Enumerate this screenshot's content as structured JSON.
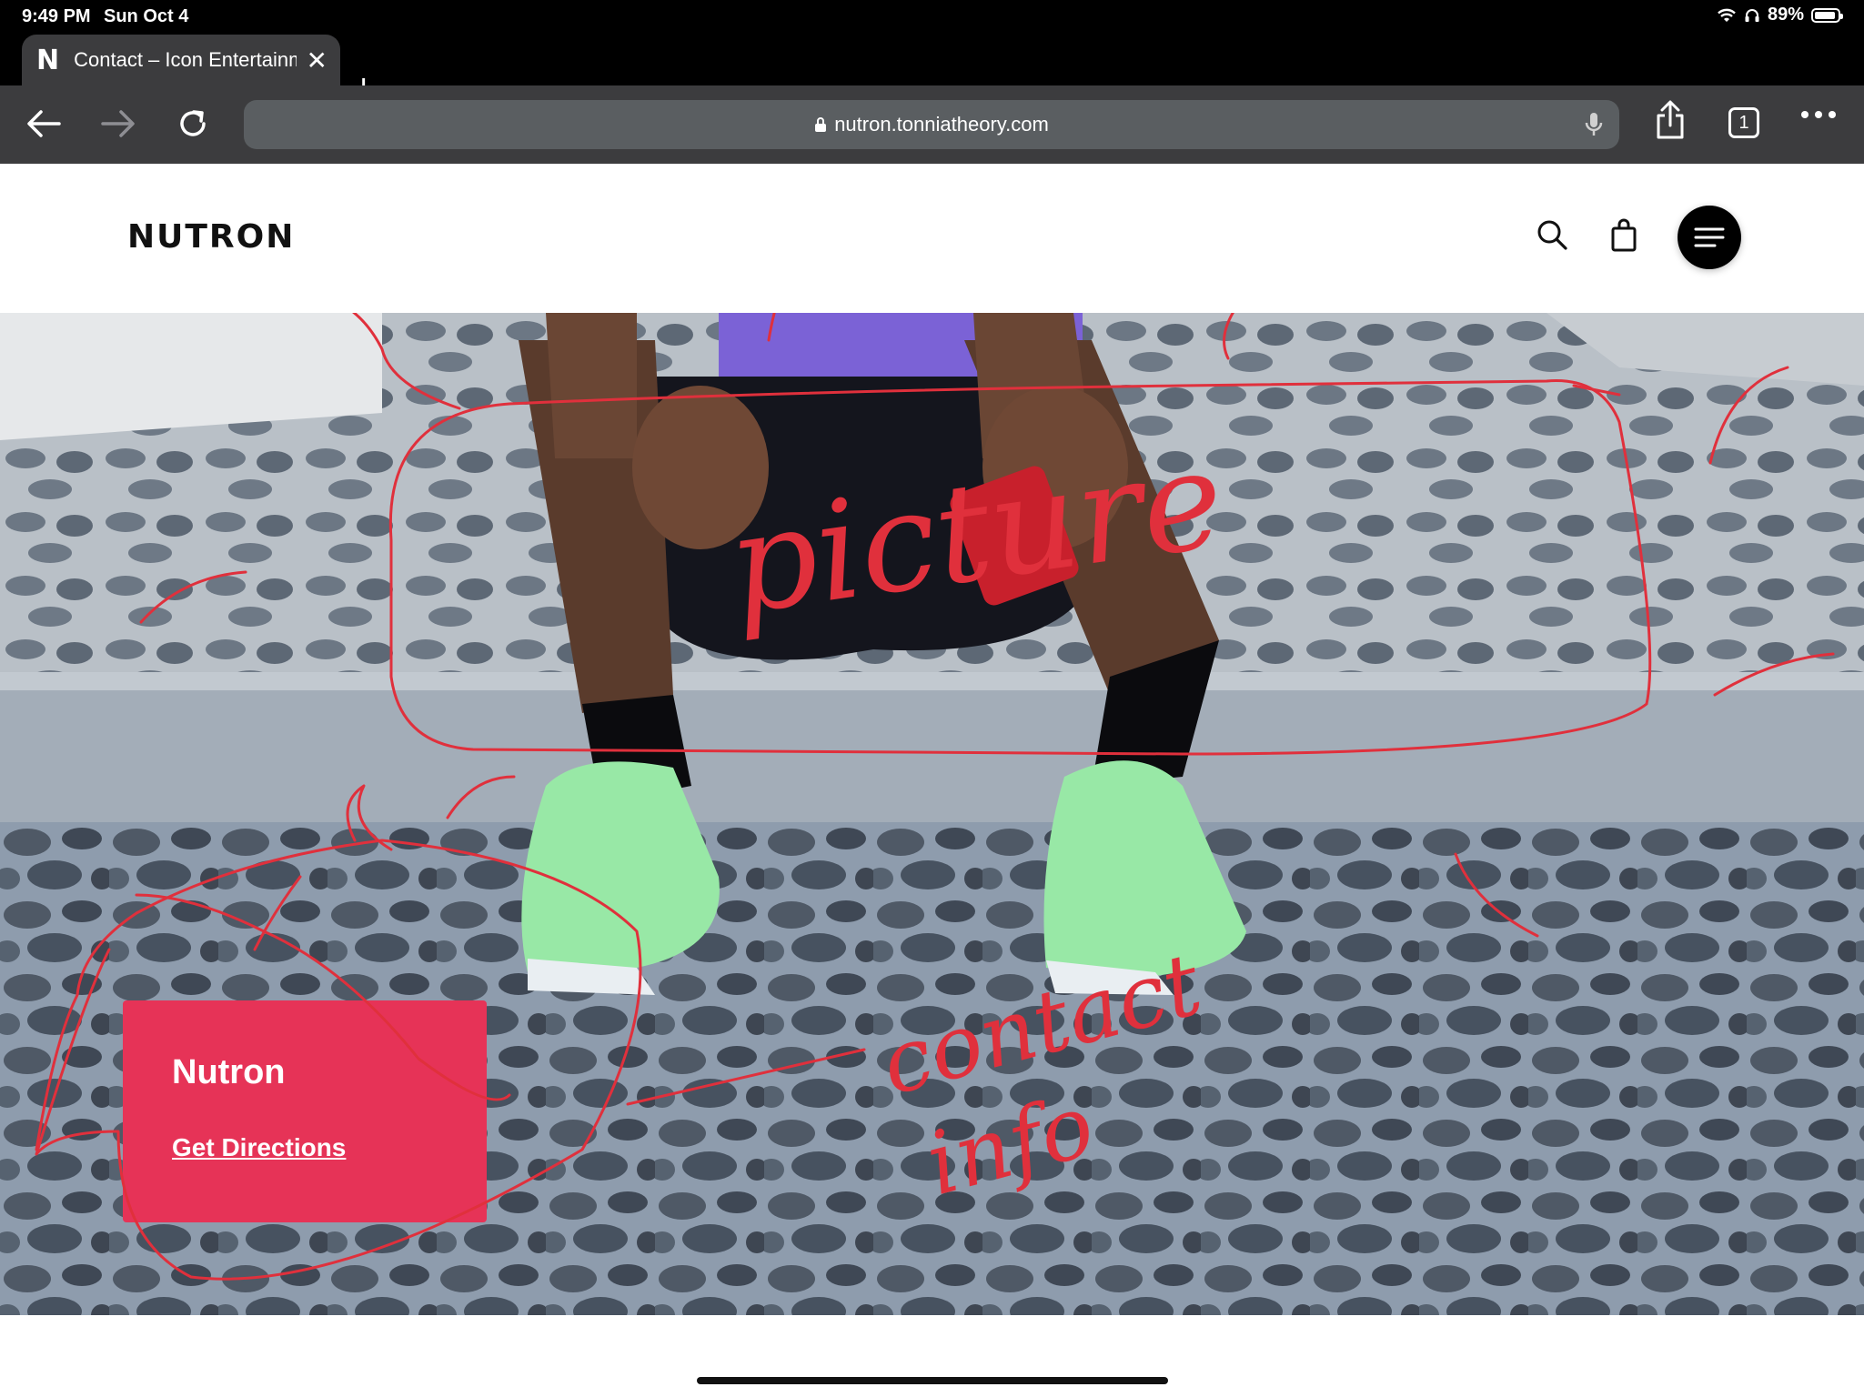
{
  "status_bar": {
    "time": "9:49 PM",
    "date": "Sun Oct 4",
    "battery": "89%",
    "icons": [
      "wifi-icon",
      "headphones-icon",
      "battery-icon"
    ]
  },
  "browser": {
    "tab_title": "Contact – Icon Entertainment",
    "favicon": "N",
    "url": "nutron.tonniatheory.com",
    "tab_count": "1",
    "icons": [
      "back-arrow-icon",
      "forward-arrow-icon",
      "reload-icon",
      "lock-icon",
      "microphone-icon",
      "share-icon",
      "tabs-icon",
      "more-icon"
    ]
  },
  "site": {
    "logo": "NUTRON",
    "header_icons": [
      "search-icon",
      "shopping-bag-icon",
      "menu-icon"
    ],
    "contact_card": {
      "name": "Nutron",
      "directions_label": "Get Directions"
    }
  },
  "annotations": {
    "picture_label": "picture",
    "contact_label_line1": "contact",
    "contact_label_line2": "info",
    "ink_color": "#e0303c"
  },
  "colors": {
    "card_background": "#e63357",
    "browser_chrome": "#3c3c3e"
  }
}
